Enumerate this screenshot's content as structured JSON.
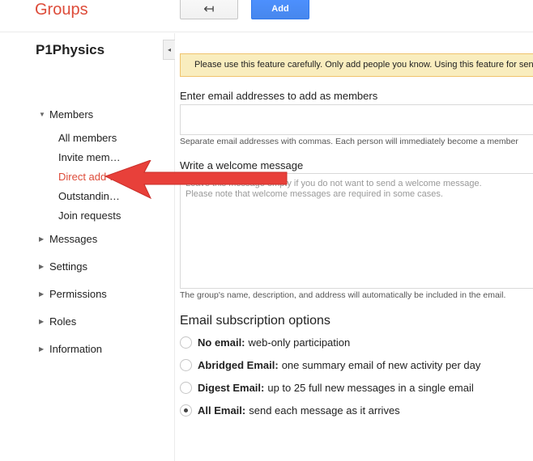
{
  "header": {
    "brand": "Groups",
    "back_icon": "↤",
    "add_label": "Add"
  },
  "sidebar": {
    "group_name": "P1Physics",
    "collapse_icon": "◂",
    "sections": {
      "members": "Members",
      "messages": "Messages",
      "settings": "Settings",
      "permissions": "Permissions",
      "roles": "Roles",
      "information": "Information"
    },
    "member_items": {
      "all": "All members",
      "invite": "Invite mem…",
      "direct": "Direct add …",
      "outstanding": "Outstandin…",
      "join": "Join requests"
    }
  },
  "main": {
    "warning": "Please use this feature carefully. Only add people you know. Using this feature for sen",
    "emails_label": "Enter email addresses to add as members",
    "emails_hint": "Separate email addresses with commas. Each person will immediately become a member",
    "welcome_label": "Write a welcome message",
    "welcome_placeholder_1": "Leave this message empty if you do not want to send a welcome message.",
    "welcome_placeholder_2": "Please note that welcome messages are required in some cases.",
    "welcome_hint": "The group's name, description, and address will automatically be included in the email.",
    "subscription_title": "Email subscription options",
    "options": [
      {
        "title": "No email:",
        "desc": "web-only participation",
        "checked": false
      },
      {
        "title": "Abridged Email:",
        "desc": "one summary email of new activity per day",
        "checked": false
      },
      {
        "title": "Digest Email:",
        "desc": "up to 25 full new messages in a single email",
        "checked": false
      },
      {
        "title": "All Email:",
        "desc": "send each message as it arrives",
        "checked": true
      }
    ]
  },
  "colors": {
    "brand": "#dd4b39",
    "primary_button": "#4d90fe",
    "warning_bg": "#f9edbe",
    "annotation_arrow": "#e8403a"
  }
}
